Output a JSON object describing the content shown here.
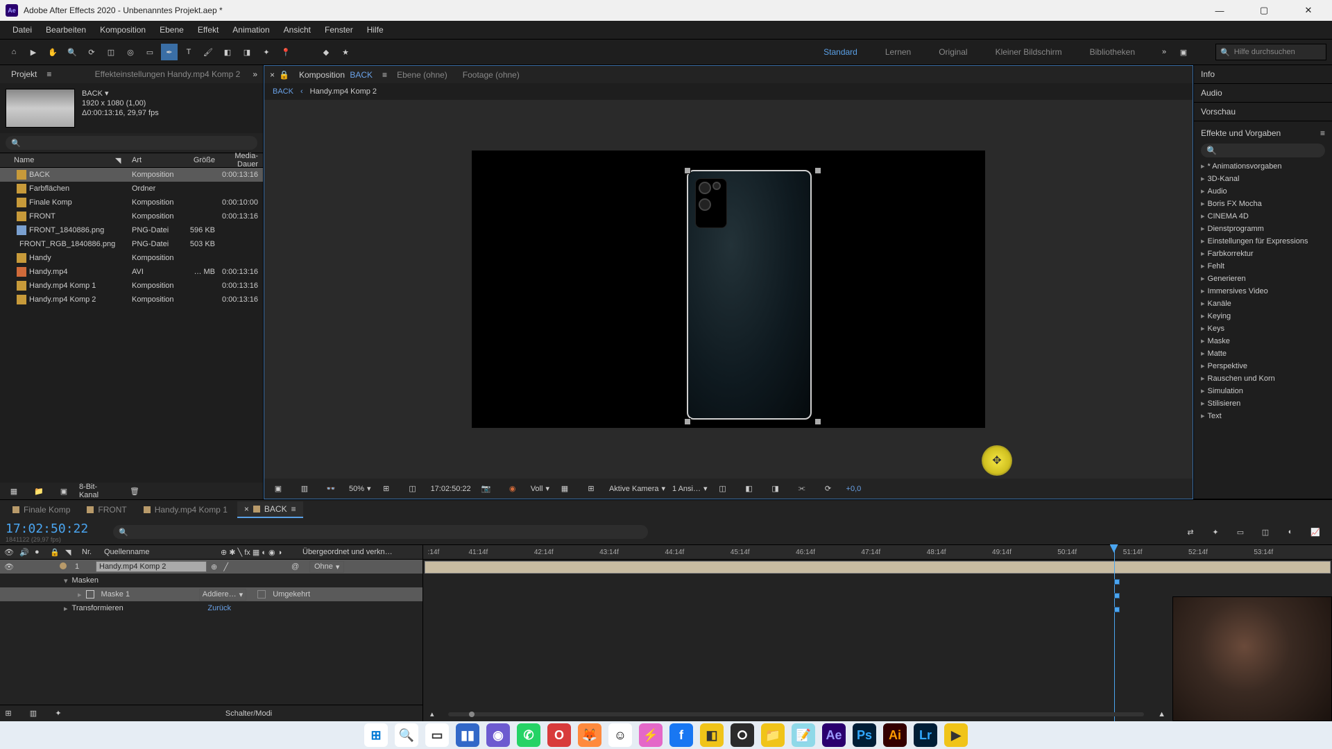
{
  "title": "Adobe After Effects 2020 - Unbenanntes Projekt.aep *",
  "app_badge": "Ae",
  "menu": [
    "Datei",
    "Bearbeiten",
    "Komposition",
    "Ebene",
    "Effekt",
    "Animation",
    "Ansicht",
    "Fenster",
    "Hilfe"
  ],
  "workspaces": {
    "items": [
      "Standard",
      "Lernen",
      "Original",
      "Kleiner Bildschirm",
      "Bibliotheken"
    ],
    "active": "Standard"
  },
  "help_search_placeholder": "Hilfe durchsuchen",
  "project": {
    "tab": "Projekt",
    "effects_tab": "Effekteinstellungen  Handy.mp4 Komp 2",
    "thumb": {
      "name": "BACK ▾",
      "dims": "1920 x 1080 (1,00)",
      "dur": "Δ0:00:13:16, 29,97 fps"
    },
    "headers": {
      "name": "Name",
      "kind": "Art",
      "size": "Größe",
      "dur": "Media-Dauer"
    },
    "rows": [
      {
        "icon": "kind-k",
        "tag": "#c79a3a",
        "name": "BACK",
        "kind": "Komposition",
        "size": "",
        "dur": "0:00:13:16",
        "sel": true
      },
      {
        "icon": "kind-f",
        "tag": "#c79a3a",
        "name": "Farbflächen",
        "kind": "Ordner",
        "size": "",
        "dur": ""
      },
      {
        "icon": "kind-k",
        "tag": "#c79a3a",
        "name": "Finale Komp",
        "kind": "Komposition",
        "size": "",
        "dur": "0:00:10:00"
      },
      {
        "icon": "kind-k",
        "tag": "#c79a3a",
        "name": "FRONT",
        "kind": "Komposition",
        "size": "",
        "dur": "0:00:13:16"
      },
      {
        "icon": "kind-p",
        "tag": "#7aa0d0",
        "name": "FRONT_1840886.png",
        "kind": "PNG-Datei",
        "size": "596 KB",
        "dur": ""
      },
      {
        "icon": "kind-p",
        "tag": "#7aa0d0",
        "name": "FRONT_RGB_1840886.png",
        "kind": "PNG-Datei",
        "size": "503 KB",
        "dur": ""
      },
      {
        "icon": "kind-h",
        "tag": "#c79a3a",
        "name": "Handy",
        "kind": "Komposition",
        "size": "",
        "dur": ""
      },
      {
        "icon": "kind-a",
        "tag": "#d06a3a",
        "name": "Handy.mp4",
        "kind": "AVI",
        "size": "… MB",
        "dur": "0:00:13:16"
      },
      {
        "icon": "kind-k",
        "tag": "#c79a3a",
        "name": "Handy.mp4 Komp 1",
        "kind": "Komposition",
        "size": "",
        "dur": "0:00:13:16"
      },
      {
        "icon": "kind-k",
        "tag": "#c79a3a",
        "name": "Handy.mp4 Komp 2",
        "kind": "Komposition",
        "size": "",
        "dur": "0:00:13:16"
      }
    ],
    "footer_label": "8-Bit-Kanal"
  },
  "comp": {
    "tabs": {
      "komposition": "Komposition",
      "active": "BACK",
      "ebene": "Ebene (ohne)",
      "footage": "Footage (ohne)"
    },
    "crumb": {
      "root": "BACK",
      "arrow": "‹",
      "child": "Handy.mp4 Komp 2"
    },
    "controls": {
      "zoom": "50%",
      "timecode": "17:02:50:22",
      "resolution": "Voll",
      "camera": "Aktive Kamera",
      "views": "1 Ansi…",
      "exposure": "+0,0"
    }
  },
  "right": {
    "panels": [
      "Info",
      "Audio",
      "Vorschau"
    ],
    "ep_title": "Effekte und Vorgaben",
    "ep_items": [
      "* Animationsvorgaben",
      "3D-Kanal",
      "Audio",
      "Boris FX Mocha",
      "CINEMA 4D",
      "Dienstprogramm",
      "Einstellungen für Expressions",
      "Farbkorrektur",
      "Fehlt",
      "Generieren",
      "Immersives Video",
      "Kanäle",
      "Keying",
      "Keys",
      "Maske",
      "Matte",
      "Perspektive",
      "Rauschen und Korn",
      "Simulation",
      "Stilisieren",
      "Text"
    ]
  },
  "timeline": {
    "tabs": [
      {
        "label": "Finale Komp"
      },
      {
        "label": "FRONT"
      },
      {
        "label": "Handy.mp4 Komp 1"
      },
      {
        "label": "BACK",
        "active": true
      }
    ],
    "timecode": "17:02:50:22",
    "framecount": "1841122 (29,97 fps)",
    "colheaders": {
      "nr": "Nr.",
      "source": "Quellenname",
      "parent": "Übergeordnet und verkn…"
    },
    "layer": {
      "num": "1",
      "name": "Handy.mp4 Komp 2",
      "parent": "Ohne"
    },
    "masken": "Masken",
    "maske1": "Maske 1",
    "mode": "Addiere…",
    "inverted": "Umgekehrt",
    "transform": "Transformieren",
    "reset": "Zurück",
    "ruler": [
      "41:14f",
      "42:14f",
      "43:14f",
      "44:14f",
      "45:14f",
      "46:14f",
      "47:14f",
      "48:14f",
      "49:14f",
      "50:14f",
      "51:14f",
      "52:14f",
      "53:14f"
    ],
    "ruler_start": ":14f",
    "footer": "Schalter/Modi"
  },
  "taskbar": [
    {
      "bg": "#ffffff",
      "fg": "#0078d4",
      "t": "⊞"
    },
    {
      "bg": "#ffffff",
      "fg": "#333",
      "t": "🔍"
    },
    {
      "bg": "#ffffff",
      "fg": "#333",
      "t": "▭"
    },
    {
      "bg": "#3268c8",
      "fg": "#fff",
      "t": "▮▮"
    },
    {
      "bg": "#6d5bd0",
      "fg": "#fff",
      "t": "◉"
    },
    {
      "bg": "#25d366",
      "fg": "#fff",
      "t": "✆"
    },
    {
      "bg": "#d83b3b",
      "fg": "#fff",
      "t": "O"
    },
    {
      "bg": "#ff8a3d",
      "fg": "#fff",
      "t": "🦊"
    },
    {
      "bg": "#ffffff",
      "fg": "#000",
      "t": "☺"
    },
    {
      "bg": "#e468c8",
      "fg": "#fff",
      "t": "⚡"
    },
    {
      "bg": "#1877f2",
      "fg": "#fff",
      "t": "f"
    },
    {
      "bg": "#f0c419",
      "fg": "#333",
      "t": "◧"
    },
    {
      "bg": "#2b2b2b",
      "fg": "#fff",
      "t": "⭘"
    },
    {
      "bg": "#f0c419",
      "fg": "#333",
      "t": "📁"
    },
    {
      "bg": "#8fd9e8",
      "fg": "#0068a8",
      "t": "📝"
    },
    {
      "bg": "#2a006e",
      "fg": "#9b9bff",
      "t": "Ae"
    },
    {
      "bg": "#001e36",
      "fg": "#31a8ff",
      "t": "Ps"
    },
    {
      "bg": "#330000",
      "fg": "#ff9a00",
      "t": "Ai"
    },
    {
      "bg": "#001e36",
      "fg": "#31a8ff",
      "t": "Lr"
    },
    {
      "bg": "#f0c419",
      "fg": "#333",
      "t": "▶"
    }
  ]
}
